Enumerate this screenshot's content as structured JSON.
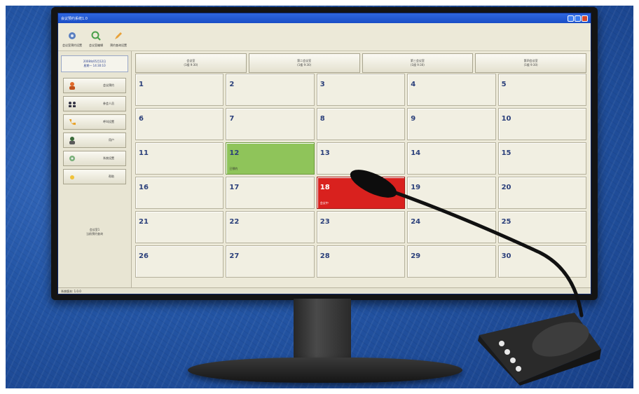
{
  "window": {
    "title": "会议预约系统1.0"
  },
  "toolbar": {
    "items": [
      {
        "label": "会议室预约设置"
      },
      {
        "label": "会议室编辑"
      },
      {
        "label": "预约查询设置"
      }
    ]
  },
  "sidebar": {
    "datetime_line1": "2008年05月12日",
    "datetime_line2": "星期一 14:30:10",
    "buttons": [
      {
        "label": "会议预约"
      },
      {
        "label": "参会人员"
      },
      {
        "label": "呼叫设置"
      },
      {
        "label": "用户"
      },
      {
        "label": "系统设置"
      },
      {
        "label": "帮助"
      }
    ],
    "note_line1": "会议室1",
    "note_line2": "当前预约查询"
  },
  "columns": [
    {
      "line1": "会议室",
      "line2": "(1楼 9:30)"
    },
    {
      "line1": "第二会议室",
      "line2": "(1楼 9:30)"
    },
    {
      "line1": "第三会议室",
      "line2": "(1楼 9:30)"
    },
    {
      "line1": "第四会议室",
      "line2": "(1楼 9:30)"
    }
  ],
  "calendar": {
    "days": [
      "1",
      "2",
      "3",
      "4",
      "5",
      "6",
      "7",
      "8",
      "9",
      "10",
      "11",
      "12",
      "13",
      "14",
      "15",
      "16",
      "17",
      "18",
      "19",
      "20",
      "21",
      "22",
      "23",
      "24",
      "25",
      "26",
      "27",
      "28",
      "29",
      "30"
    ],
    "highlight_green": {
      "day": "12",
      "note": "已预约"
    },
    "highlight_red": {
      "day": "18",
      "note": "会议中"
    }
  },
  "statusbar": {
    "text": "系统版本: 1.0.0"
  },
  "colors": {
    "wall": "#2456a6",
    "titlebar": "#1a4ec6",
    "cell": "#f1efe2",
    "booked_green": "#8fc45a",
    "active_red": "#d9211e"
  }
}
